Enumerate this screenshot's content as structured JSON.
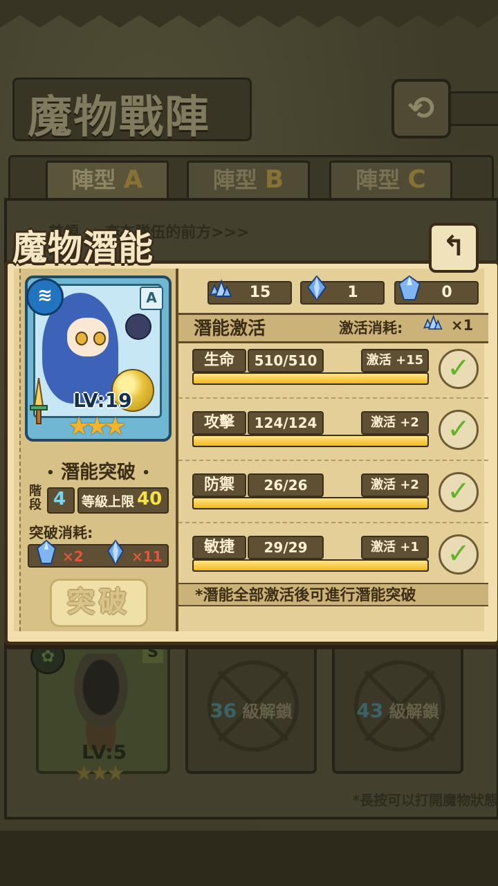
{
  "background": {
    "screen_title": "魔物戰陣",
    "back_icon": "return-arrow-icon",
    "tabs": [
      {
        "label": "陣型",
        "letter": "A"
      },
      {
        "label": "陣型",
        "letter": "B"
      },
      {
        "label": "陣型",
        "letter": "C"
      }
    ],
    "hint_partial": "首領 … 奔在隊伍的前方>>>",
    "slots": [
      {
        "char_level": "LV:5",
        "rank": "S"
      },
      {
        "unlock_level": "36",
        "unlock_text": "級解鎖"
      },
      {
        "unlock_level": "43",
        "unlock_text": "級解鎖"
      }
    ],
    "bottom_hint": "*長按可以打開魔物狀態"
  },
  "popup": {
    "title": "魔物潛能",
    "back_icon": "return-arrow-icon",
    "character": {
      "level": "LV:19",
      "rank": "A",
      "element_icon": "water-element-icon",
      "stars": "★★★"
    },
    "breakthrough": {
      "section_title": "潛能突破",
      "stage_label": "階段",
      "stage_value": "4",
      "level_cap_label": "等級上限",
      "level_cap_value": "40",
      "cost_label": "突破消耗:",
      "costs": [
        {
          "icon": "large-crystal-icon",
          "count": "×2"
        },
        {
          "icon": "shard-crystal-icon",
          "count": "×11"
        }
      ],
      "button_label": "突破"
    },
    "resources": [
      {
        "icon": "crystal-cluster-icon",
        "value": "15"
      },
      {
        "icon": "shard-crystal-icon",
        "value": "1"
      },
      {
        "icon": "large-crystal-icon",
        "value": "0"
      }
    ],
    "activation": {
      "title": "潛能激活",
      "cost_label": "激活消耗:",
      "cost_icon": "crystal-cluster-icon",
      "cost_count": "×1",
      "stats": [
        {
          "name": "生命",
          "value": "510/510",
          "bonus": "激活 +15",
          "progress": 1.0
        },
        {
          "name": "攻擊",
          "value": "124/124",
          "bonus": "激活 +2",
          "progress": 1.0
        },
        {
          "name": "防禦",
          "value": "26/26",
          "bonus": "激活 +2",
          "progress": 1.0
        },
        {
          "name": "敏捷",
          "value": "29/29",
          "bonus": "激活 +1",
          "progress": 1.0
        }
      ],
      "note": "*潛能全部激活後可進行潛能突破"
    }
  },
  "colors": {
    "panel_light": "#f1dfae",
    "panel_dark": "#5f5034",
    "progress_fill": "#f2b91c",
    "check_green": "#63b22a",
    "level_cap_yellow": "#f4e24a",
    "stage_blue": "#7ad5ef",
    "cost_red": "#e5553c"
  }
}
